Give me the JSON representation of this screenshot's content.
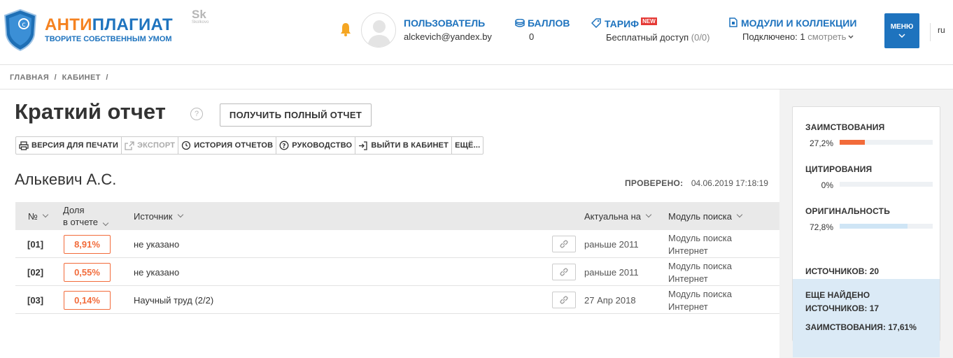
{
  "header": {
    "logo_part1": "АНТИ",
    "logo_part2": "ПЛАГИАТ",
    "logo_tagline": "ТВОРИТЕ СОБСТВЕННЫМ УМОМ",
    "partner_logo": "Sk",
    "partner_logo_sub": "Skolkovo",
    "user_label": "ПОЛЬЗОВАТЕЛЬ",
    "user_email": "alckevich@yandex.by",
    "points_label": "БАЛЛОВ",
    "points_value": "0",
    "tariff_label": "ТАРИФ",
    "tariff_badge": "NEW",
    "tariff_value": "Бесплатный доступ",
    "tariff_count": "(0/0)",
    "modules_label": "МОДУЛИ И КОЛЛЕКЦИИ",
    "modules_value": "Подключено: 1",
    "modules_link": "смотреть",
    "menu_label": "МЕНЮ",
    "lang": "ru"
  },
  "breadcrumb": [
    "ГЛАВНАЯ",
    "/",
    "КАБИНЕТ",
    "/"
  ],
  "main": {
    "title": "Краткий отчет",
    "help": "?",
    "full_report_button": "ПОЛУЧИТЬ ПОЛНЫЙ ОТЧЕТ",
    "toolbar": {
      "print": "ВЕРСИЯ ДЛЯ ПЕЧАТИ",
      "export": "ЭКСПОРТ",
      "history": "ИСТОРИЯ ОТЧЕТОВ",
      "guide": "РУКОВОДСТВО",
      "exit": "ВЫЙТИ В КАБИНЕТ",
      "more": "ЕЩЁ..."
    },
    "author": "Алькевич А.С.",
    "checked_label": "ПРОВЕРЕНО:",
    "checked_date": "04.06.2019 17:18:19"
  },
  "table": {
    "columns": {
      "num": "№",
      "share_line1": "Доля",
      "share_line2": "в отчете",
      "source": "Источник",
      "actual": "Актуальна на",
      "module": "Модуль поиска"
    },
    "rows": [
      {
        "num": "[01]",
        "share": "8,91%",
        "source": "не указано",
        "actual": "раньше 2011",
        "module1": "Модуль поиска",
        "module2": "Интернет"
      },
      {
        "num": "[02]",
        "share": "0,55%",
        "source": "не указано",
        "actual": "раньше 2011",
        "module1": "Модуль поиска",
        "module2": "Интернет"
      },
      {
        "num": "[03]",
        "share": "0,14%",
        "source": "Научный труд (2/2)",
        "actual": "27 Апр 2018",
        "module1": "Модуль поиска",
        "module2": "Интернет"
      }
    ]
  },
  "stats": {
    "borrow_label": "ЗАИМСТВОВАНИЯ",
    "borrow_value": "27,2%",
    "borrow_fraction": 0.272,
    "borrow_color": "#f26b3a",
    "cite_label": "ЦИТИРОВАНИЯ",
    "cite_value": "0%",
    "cite_fraction": 0,
    "cite_color": "#4caf50",
    "orig_label": "ОРИГИНАЛЬНОСТЬ",
    "orig_value": "72,8%",
    "orig_fraction": 0.728,
    "orig_color": "#cfe5f5",
    "sources_label": "ИСТОЧНИКОВ:",
    "sources_value": "20",
    "more_line1": "ЕЩЕ НАЙДЕНО",
    "more_line2_label": "ИСТОЧНИКОВ:",
    "more_line2_value": "17",
    "more_line3_label": "ЗАИМСТВОВАНИЯ:",
    "more_line3_value": "17,61%"
  },
  "colors": {
    "brand_blue": "#1e73be",
    "brand_orange": "#f58220",
    "accent_orange": "#f26b3a"
  }
}
